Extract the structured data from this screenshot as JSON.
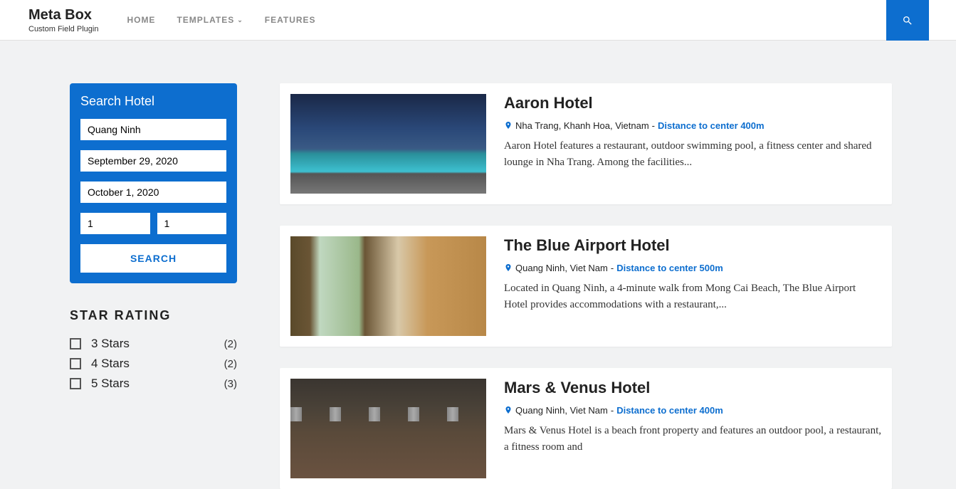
{
  "header": {
    "brand_title": "Meta Box",
    "brand_subtitle": "Custom Field Plugin",
    "nav": [
      "HOME",
      "TEMPLATES",
      "FEATURES"
    ]
  },
  "search": {
    "title": "Search Hotel",
    "location": "Quang Ninh",
    "checkin": "September 29, 2020",
    "checkout": "October 1, 2020",
    "guests1": "1",
    "guests2": "1",
    "button": "SEARCH"
  },
  "filter": {
    "title": "STAR RATING",
    "items": [
      {
        "label": "3 Stars",
        "count": "(2)"
      },
      {
        "label": "4 Stars",
        "count": "(2)"
      },
      {
        "label": "5 Stars",
        "count": "(3)"
      }
    ]
  },
  "hotels": [
    {
      "name": "Aaron Hotel",
      "location": "Nha Trang, Khanh Hoa, Vietnam",
      "distance": "Distance to center 400m",
      "description": "Aaron Hotel features a restaurant, outdoor swimming pool, a fitness center and shared lounge in Nha Trang. Among the facilities..."
    },
    {
      "name": "The Blue Airport Hotel",
      "location": "Quang Ninh, Viet Nam",
      "distance": "Distance to center 500m",
      "description": "Located in Quang Ninh, a 4-minute walk from Mong Cai Beach, The Blue Airport Hotel provides accommodations with a restaurant,..."
    },
    {
      "name": "Mars & Venus Hotel",
      "location": "Quang Ninh, Viet Nam",
      "distance": "Distance to center 400m",
      "description": "Mars & Venus Hotel is a beach front property and features an outdoor pool, a restaurant, a fitness room and"
    }
  ]
}
